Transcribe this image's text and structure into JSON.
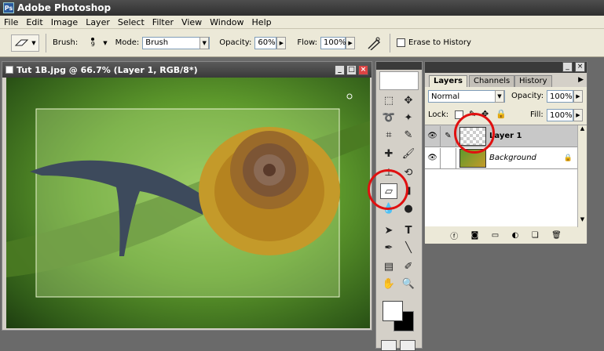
{
  "app": {
    "title": "Adobe Photoshop"
  },
  "menu": {
    "items": [
      "File",
      "Edit",
      "Image",
      "Layer",
      "Select",
      "Filter",
      "View",
      "Window",
      "Help"
    ]
  },
  "options": {
    "brush_label": "Brush:",
    "brush_size": "9",
    "mode_label": "Mode:",
    "mode_value": "Brush",
    "opacity_label": "Opacity:",
    "opacity_value": "60%",
    "flow_label": "Flow:",
    "flow_value": "100%",
    "erase_history_label": "Erase to History"
  },
  "document": {
    "title": "Tut 1B.jpg @ 66.7% (Layer 1, RGB/8*)"
  },
  "layers_panel": {
    "tabs": [
      "Layers",
      "Channels",
      "History"
    ],
    "blend_mode": "Normal",
    "opacity_label": "Opacity:",
    "opacity_value": "100%",
    "lock_label": "Lock:",
    "fill_label": "Fill:",
    "fill_value": "100%",
    "layers": [
      {
        "name": "Layer 1"
      },
      {
        "name": "Background"
      }
    ]
  },
  "colors": {
    "highlight_circle": "#e01010",
    "titlebar": "#3a3a3a",
    "panel_bg": "#d4d0c8"
  }
}
